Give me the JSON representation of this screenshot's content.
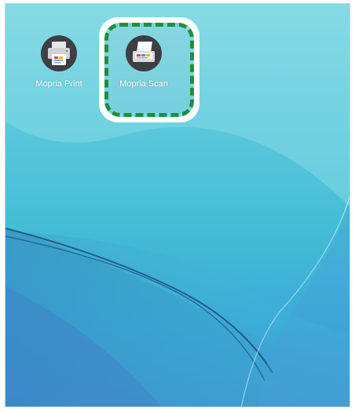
{
  "home_screen": {
    "apps": [
      {
        "label": "Mopria Print",
        "icon": "printer-icon"
      },
      {
        "label": "Mopria Scan",
        "icon": "scanner-icon"
      }
    ],
    "highlighted_app": "Mopria Scan",
    "highlight_color": "#1f8f3a",
    "icon_background": "#3d3f43"
  }
}
